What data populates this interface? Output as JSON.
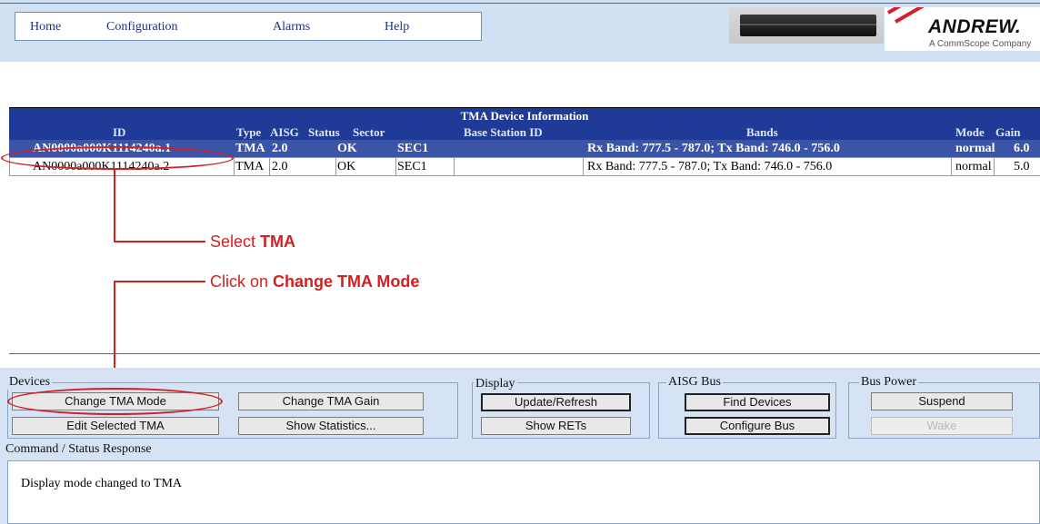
{
  "nav": {
    "home": "Home",
    "configuration": "Configuration",
    "alarms": "Alarms",
    "help": "Help"
  },
  "logo": {
    "name": "ANDREW.",
    "sub": "A CommScope Company"
  },
  "table": {
    "title": "TMA Device Information",
    "columns": [
      "ID",
      "Type",
      "AISG",
      "Status",
      "Sector",
      "Base Station ID",
      "Bands",
      "Mode",
      "Gain"
    ],
    "rows": [
      {
        "id": "AN0000a000K1114240a.1",
        "type": "TMA",
        "aisg": "2.0",
        "status": "OK",
        "sector": "SEC1",
        "base_station_id": "",
        "bands": "Rx Band: 777.5 - 787.0; Tx Band: 746.0 - 756.0",
        "mode": "normal",
        "gain": "6.0",
        "selected": true
      },
      {
        "id": "AN0000a000K1114240a.2",
        "type": "TMA",
        "aisg": "2.0",
        "status": "OK",
        "sector": "SEC1",
        "base_station_id": "",
        "bands": "Rx Band: 777.5 - 787.0; Tx Band: 746.0 - 756.0",
        "mode": "normal",
        "gain": "5.0",
        "selected": false
      }
    ]
  },
  "annotations": {
    "select_prefix": "Select ",
    "select_bold": "TMA",
    "click_prefix": "Click on ",
    "click_bold": "Change TMA Mode"
  },
  "panel": {
    "devices": {
      "label": "Devices",
      "change_mode": "Change TMA Mode",
      "change_gain": "Change TMA Gain",
      "edit": "Edit Selected TMA",
      "stats": "Show Statistics..."
    },
    "display": {
      "label": "Display",
      "refresh": "Update/Refresh",
      "show_rets": "Show RETs"
    },
    "aisg_bus": {
      "label": "AISG Bus",
      "find": "Find Devices",
      "configure": "Configure Bus"
    },
    "bus_power": {
      "label": "Bus Power",
      "suspend": "Suspend",
      "wake": "Wake"
    }
  },
  "status": {
    "label": "Command / Status Response",
    "message": "Display mode changed to TMA"
  },
  "colors": {
    "accent_red": "#d32020",
    "header_blue": "#1f3b97",
    "selected_row": "#3a55a7",
    "panel_bg": "#d5e3f5"
  }
}
